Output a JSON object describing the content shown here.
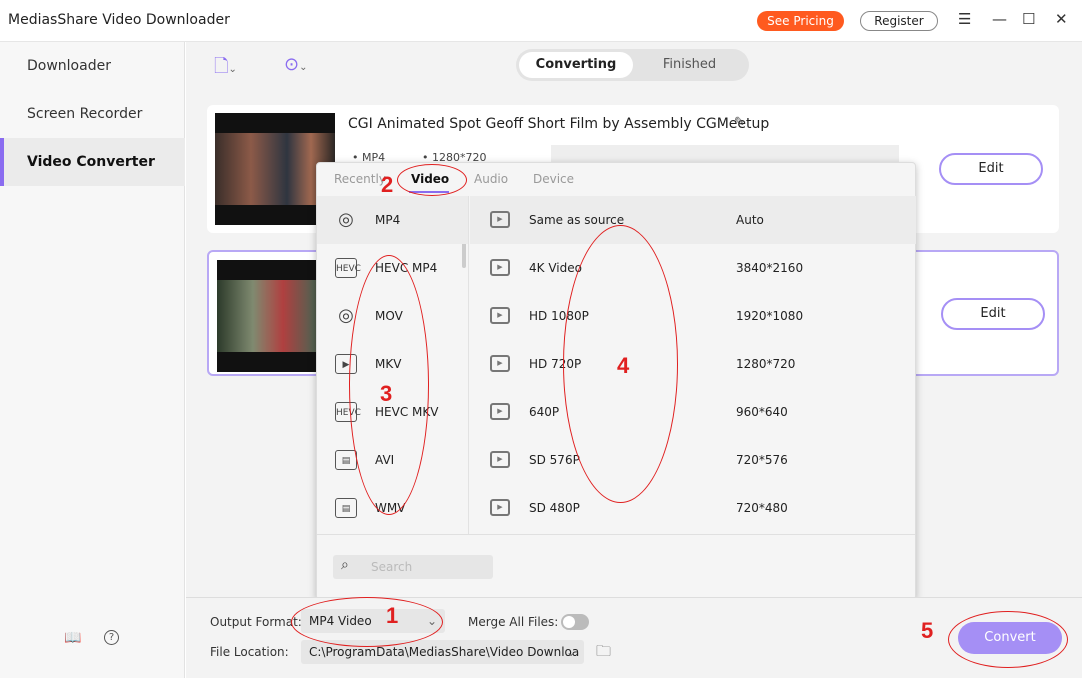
{
  "app": {
    "title": "MediasShare Video Downloader",
    "pricing": "See Pricing",
    "register": "Register"
  },
  "sidebar": {
    "items": [
      {
        "label": "Downloader"
      },
      {
        "label": "Screen Recorder"
      },
      {
        "label": "Video Converter",
        "active": true
      }
    ]
  },
  "segment": {
    "converting": "Converting",
    "finished": "Finished"
  },
  "files": [
    {
      "title": "CGI Animated Spot Geoff Short Film by Assembly  CGMeetup",
      "format": "MP4",
      "resolution": "1280*720",
      "edit": "Edit"
    },
    {
      "edit": "Edit"
    }
  ],
  "popup": {
    "tabs": [
      "Recently",
      "Video",
      "Audio",
      "Device"
    ],
    "formats": [
      {
        "label": "MP4",
        "icon": "disc"
      },
      {
        "label": "HEVC MP4",
        "icon": "HEVC"
      },
      {
        "label": "MOV",
        "icon": "disc"
      },
      {
        "label": "MKV",
        "icon": "video"
      },
      {
        "label": "HEVC MKV",
        "icon": "HEVC"
      },
      {
        "label": "AVI",
        "icon": "clapper"
      },
      {
        "label": "WMV",
        "icon": "clapper"
      }
    ],
    "presets": [
      {
        "name": "Same as source",
        "res": "Auto"
      },
      {
        "name": "4K Video",
        "res": "3840*2160"
      },
      {
        "name": "HD 1080P",
        "res": "1920*1080"
      },
      {
        "name": "HD 720P",
        "res": "1280*720"
      },
      {
        "name": "640P",
        "res": "960*640"
      },
      {
        "name": "SD 576P",
        "res": "720*576"
      },
      {
        "name": "SD 480P",
        "res": "720*480"
      }
    ],
    "search_placeholder": "Search"
  },
  "bottom": {
    "output_format_label": "Output Format:",
    "output_format": "MP4 Video",
    "merge_label": "Merge All Files:",
    "merge_on": false,
    "location_label": "File Location:",
    "location": "C:\\ProgramData\\MediasShare\\Video Downloa",
    "convert": "Convert"
  },
  "annotations": [
    "1",
    "2",
    "3",
    "4",
    "5"
  ],
  "colors": {
    "accent": "#a58ff5",
    "pricing": "#ff5a1f",
    "annotation": "#e02020"
  }
}
